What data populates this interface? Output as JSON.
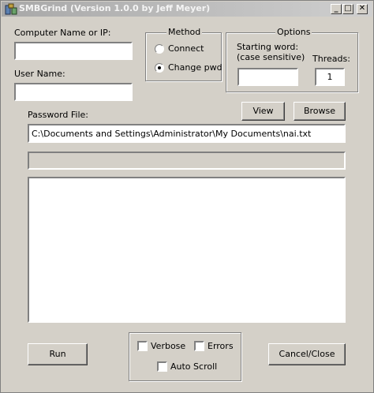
{
  "window": {
    "title": "SMBGrind (Version 1.0.0 by Jeff Meyer)",
    "minimize_glyph": "_",
    "maximize_glyph": "□",
    "close_glyph": "✕"
  },
  "fields": {
    "computer_label": "Computer Name or IP:",
    "computer_value": "",
    "username_label": "User Name:",
    "username_value": "",
    "password_file_label": "Password File:",
    "password_file_value": "C:\\Documents and Settings\\Administrator\\My Documents\\nai.txt"
  },
  "method": {
    "caption": "Method",
    "options": [
      {
        "label": "Connect",
        "selected": false
      },
      {
        "label": "Change pwd",
        "selected": true
      }
    ]
  },
  "options_group": {
    "caption": "Options",
    "starting_word_label_1": "Starting word:",
    "starting_word_label_2": "(case sensitive)",
    "starting_word_value": "",
    "threads_label": "Threads:",
    "threads_value": "1"
  },
  "buttons": {
    "view": "View",
    "browse": "Browse",
    "run": "Run",
    "cancel": "Cancel/Close"
  },
  "checks": {
    "verbose": {
      "label": "Verbose",
      "checked": false
    },
    "errors": {
      "label": "Errors",
      "checked": false
    },
    "auto_scroll": {
      "label": "Auto Scroll",
      "checked": false
    }
  },
  "progress": {
    "value": 0
  }
}
